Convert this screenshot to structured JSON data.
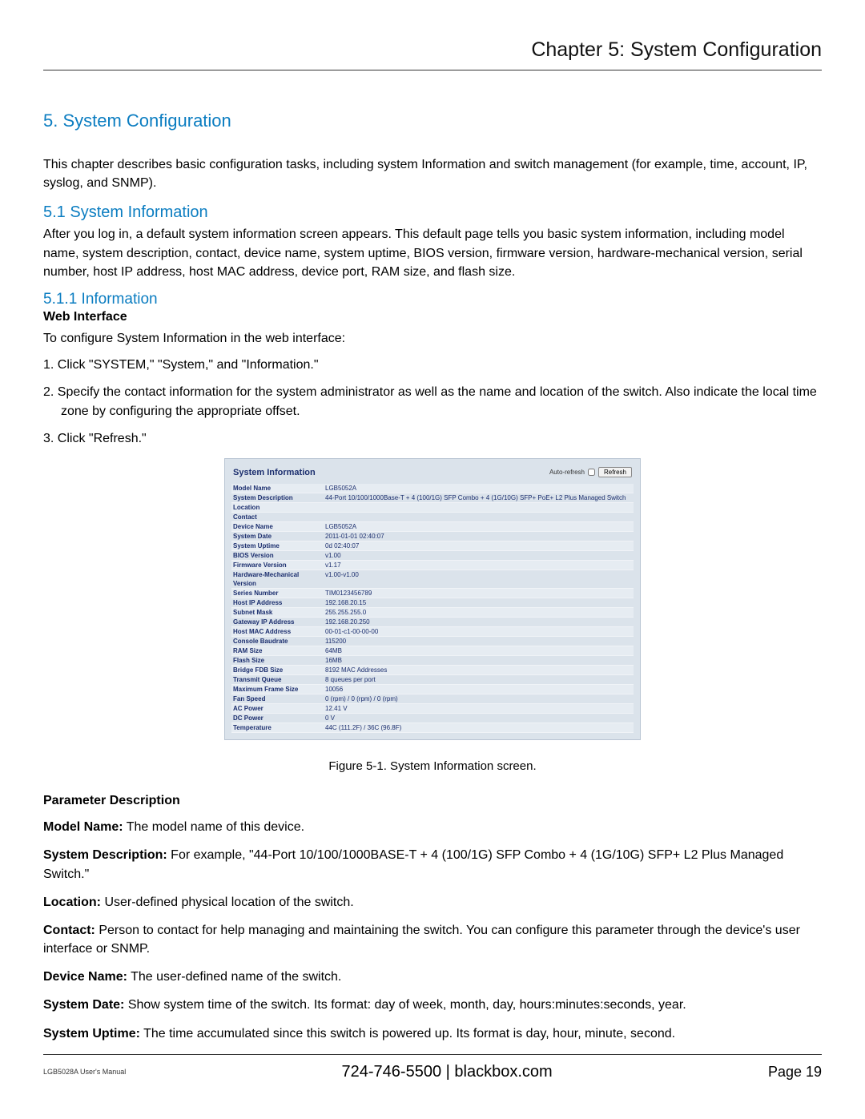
{
  "header": {
    "chapter": "Chapter 5: System Configuration"
  },
  "sections": {
    "h1": "5. System Configuration",
    "intro": "This chapter describes basic configuration tasks, including system Information and switch management (for example, time, account, IP, syslog, and SNMP).",
    "h2": "5.1 System Information",
    "p51": "After you log in, a default system information screen appears. This default page tells you basic system information, including model name, system description, contact, device name, system uptime, BIOS version, firmware version, hardware-mechanical version, serial number, host IP address, host MAC address, device port, RAM size, and flash size.",
    "h3": "5.1.1 Information",
    "h4": "Web Interface",
    "p_web": "To configure System Information in the web interface:",
    "step1": "1. Click \"SYSTEM,\" \"System,\" and \"Information.\"",
    "step2": "2. Specify the contact information for the system administrator as well as the name and location of the switch. Also indicate the local time zone by configuring the appropriate offset.",
    "step3": "3. Click \"Refresh.\""
  },
  "panel": {
    "title": "System Information",
    "auto_refresh_label": "Auto-refresh",
    "refresh_label": "Refresh",
    "rows": [
      {
        "label": "Model Name",
        "value": "LGB5052A"
      },
      {
        "label": "System Description",
        "value": "44-Port 10/100/1000Base-T + 4 (100/1G) SFP Combo + 4 (1G/10G) SFP+ PoE+ L2 Plus Managed Switch"
      },
      {
        "label": "Location",
        "value": ""
      },
      {
        "label": "Contact",
        "value": ""
      },
      {
        "label": "Device Name",
        "value": "LGB5052A"
      },
      {
        "label": "System Date",
        "value": "2011-01-01 02:40:07"
      },
      {
        "label": "System Uptime",
        "value": "0d 02:40:07"
      },
      {
        "label": "BIOS Version",
        "value": "v1.00"
      },
      {
        "label": "Firmware Version",
        "value": "v1.17"
      },
      {
        "label": "Hardware-Mechanical Version",
        "value": "v1.00-v1.00"
      },
      {
        "label": "Series Number",
        "value": "TIM0123456789"
      },
      {
        "label": "Host IP Address",
        "value": "192.168.20.15"
      },
      {
        "label": "Subnet Mask",
        "value": "255.255.255.0"
      },
      {
        "label": "Gateway IP Address",
        "value": "192.168.20.250"
      },
      {
        "label": "Host MAC Address",
        "value": "00-01-c1-00-00-00"
      },
      {
        "label": "Console Baudrate",
        "value": "115200"
      },
      {
        "label": "RAM Size",
        "value": "64MB"
      },
      {
        "label": "Flash Size",
        "value": "16MB"
      },
      {
        "label": "Bridge FDB Size",
        "value": "8192 MAC Addresses"
      },
      {
        "label": "Transmit Queue",
        "value": "8 queues per port"
      },
      {
        "label": "Maximum Frame Size",
        "value": "10056"
      },
      {
        "label": "Fan Speed",
        "value": "0 (rpm) / 0 (rpm) / 0 (rpm)"
      },
      {
        "label": "AC Power",
        "value": "12.41 V"
      },
      {
        "label": "DC Power",
        "value": "0 V"
      },
      {
        "label": "Temperature",
        "value": "44C (111.2F) / 36C (96.8F)"
      }
    ]
  },
  "caption": "Figure 5-1. System Information screen.",
  "params": {
    "title": "Parameter Description",
    "items": [
      {
        "name": "Model Name:",
        "desc": " The model name of this device."
      },
      {
        "name": "System Description:",
        "desc": " For example, \"44-Port 10/100/1000BASE-T + 4 (100/1G) SFP Combo + 4 (1G/10G) SFP+ L2 Plus Managed Switch.\""
      },
      {
        "name": "Location:",
        "desc": " User-defined physical location of the switch."
      },
      {
        "name": "Contact:",
        "desc": " Person to contact for help managing and maintaining the switch. You can configure this parameter through the device's user interface or SNMP."
      },
      {
        "name": "Device Name:",
        "desc": " The user-defined name of the switch."
      },
      {
        "name": "System Date:",
        "desc": " Show system time of the switch. Its format: day of week, month, day, hours:minutes:seconds, year."
      },
      {
        "name": "System Uptime:",
        "desc": " The time accumulated since this switch is powered up. Its format is day, hour, minute, second."
      }
    ]
  },
  "footer": {
    "manual": "LGB5028A User's Manual",
    "center_phone": "724-746-5500",
    "center_sep": "   |   ",
    "center_site": "blackbox.com",
    "page": "Page 19"
  }
}
